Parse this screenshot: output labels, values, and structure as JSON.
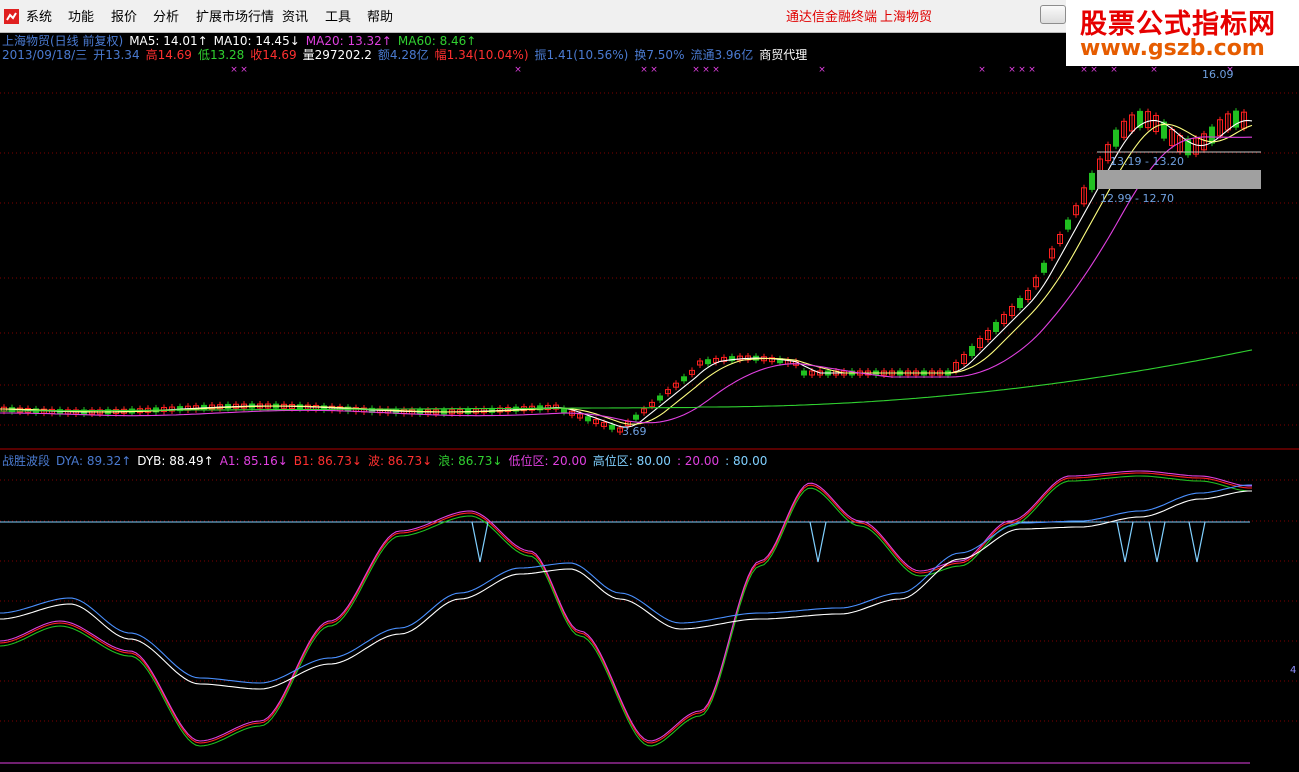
{
  "menu": {
    "items": [
      "系统",
      "功能",
      "报价",
      "分析",
      "扩展市场行情",
      "资讯",
      "工具",
      "帮助"
    ],
    "right_links": [
      "通达信金融终端",
      "上海物贸"
    ]
  },
  "watermark": {
    "title": "股票公式指标网",
    "url": "www.gszb.com"
  },
  "header": {
    "line1": [
      {
        "text": "上海物贸(日线 前复权)",
        "color": "#4a7ad0"
      },
      {
        "text": "MA5: 14.01↑",
        "color": "#ffffff"
      },
      {
        "text": "MA10: 14.45↓",
        "color": "#ffffff"
      },
      {
        "text": "MA20: 13.32↑",
        "color": "#e040e0"
      },
      {
        "text": "MA60: 8.46↑",
        "color": "#30d030"
      }
    ],
    "line2": [
      {
        "text": "2013/09/18/三",
        "color": "#4a7ad0"
      },
      {
        "text": "开13.34",
        "color": "#4a7ad0"
      },
      {
        "text": "高14.69",
        "color": "#ff3030"
      },
      {
        "text": "低13.28",
        "color": "#30d030"
      },
      {
        "text": "收14.69",
        "color": "#ff3030"
      },
      {
        "text": "量297202.2",
        "color": "#ffffff"
      },
      {
        "text": "额4.28亿",
        "color": "#4a7ad0"
      },
      {
        "text": "幅1.34(10.04%)",
        "color": "#ff3030"
      },
      {
        "text": "振1.41(10.56%)",
        "color": "#4a7ad0"
      },
      {
        "text": "换7.50%",
        "color": "#4a7ad0"
      },
      {
        "text": "流通3.96亿",
        "color": "#4a7ad0"
      },
      {
        "text": "商贸代理",
        "color": "#ffffff"
      }
    ]
  },
  "indicator": {
    "line": [
      {
        "text": "战胜波段",
        "color": "#4a7ad0"
      },
      {
        "text": "DYA: 89.32↑",
        "color": "#4a7ad0"
      },
      {
        "text": "DYB: 88.49↑",
        "color": "#ffffff"
      },
      {
        "text": "A1: 85.16↓",
        "color": "#e040e0"
      },
      {
        "text": "B1: 86.73↓",
        "color": "#ff3030"
      },
      {
        "text": "波: 86.73↓",
        "color": "#ff3030"
      },
      {
        "text": "浪: 86.73↓",
        "color": "#30d030"
      },
      {
        "text": "低位区: 20.00",
        "color": "#e040e0"
      },
      {
        "text": "高位区: 80.00",
        "color": "#80d0ff"
      },
      {
        "text": ": 20.00",
        "color": "#e040e0"
      },
      {
        "text": ": 80.00",
        "color": "#80d0ff"
      }
    ]
  },
  "price_labels": {
    "high": "16.09",
    "low": "3.69",
    "zone1": "13.19 - 13.20",
    "zone2": "12.99 - 12.70"
  },
  "right_axis_label": "4",
  "colors": {
    "up": "#ff2020",
    "down": "#20c020",
    "ma5": "#ffffff",
    "ma10": "#ffff80",
    "ma20": "#e040e0",
    "ma60": "#30d030",
    "grid": "#800000"
  }
}
